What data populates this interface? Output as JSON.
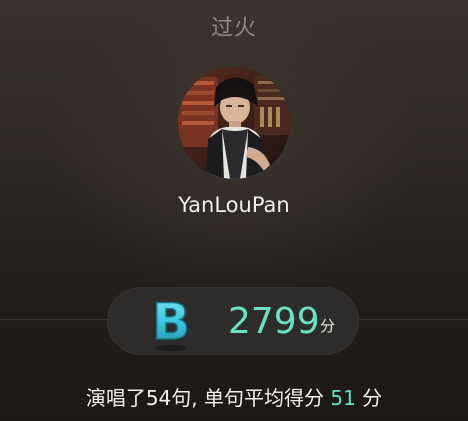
{
  "song": {
    "title": "过火"
  },
  "user": {
    "name": "YanLouPan",
    "avatar": "user-avatar-photo"
  },
  "result": {
    "grade": "B",
    "score": "2799",
    "score_unit": "分",
    "summary_prefix": "演唱了54句, 单句平均得分",
    "average": "51",
    "average_unit": "分"
  },
  "colors": {
    "accent": "#66e2c4",
    "title_text": "#8f8880",
    "grade_badge": "#3cc6dc"
  }
}
